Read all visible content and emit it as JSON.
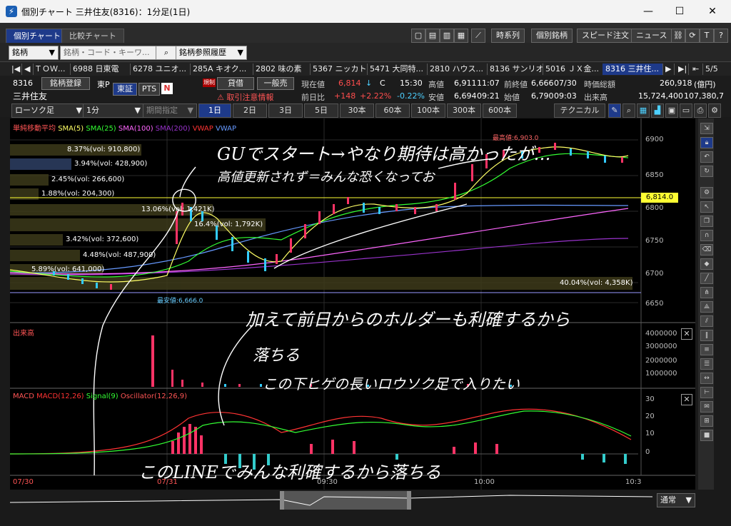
{
  "window": {
    "title": "個別チャート 三井住友(8316)：1分足(1日)",
    "icon_glyph": "⚡"
  },
  "tabs": [
    "個別チャート",
    "比較チャート"
  ],
  "top_buttons": [
    "時系列",
    "個別銘柄",
    "スピード注文",
    "ニュース"
  ],
  "row2": {
    "mode": "銘柄",
    "search_placeholder": "銘柄・コード・キーワ...",
    "history": "銘柄参照履歴"
  },
  "quick_items": [
    "ＴＯＷ...",
    "6988 日東電",
    "6278 ユニオ...",
    "285A キオク...",
    "2802 味の素",
    "5367 ニッカトー",
    "5471 大同特...",
    "2810 ハウス...",
    "8136 サンリオ",
    "5016 ＪＸ金...",
    "8316 三井住..."
  ],
  "quick_page": "5/5",
  "stock": {
    "code": "8316",
    "name": "三井住友",
    "register": "銘柄登録",
    "market": "東P",
    "exchange": "東証",
    "pts": "PTS",
    "lend": "貸借",
    "general": "一般売",
    "warn_badge": "規制",
    "warn": "取引注意情報",
    "current_label": "現在値",
    "current": "6,814",
    "current_arrow": "↓",
    "current_flag": "C",
    "current_time": "15:30",
    "prev_label": "前日比",
    "change": "+148",
    "change_pct": "+2.22%",
    "change2": "-0.22%",
    "high_label": "高値",
    "high": "6,911",
    "high_time": "11:07",
    "low_label": "安値",
    "low": "6,694",
    "low_time": "09:21",
    "prevclose_label": "前終値",
    "prevclose": "6,666",
    "prevclose_date": "07/30",
    "open_label": "始値",
    "open": "6,790",
    "open_time": "09:03",
    "mcap_label": "時価総額",
    "mcap": "260,918",
    "mcap_unit": "(億円)",
    "volume_label": "出来高",
    "volume": "15,724,400",
    "volume2": "107,380,7"
  },
  "toolrow": {
    "chart_type": "ローソク足",
    "interval": "1分",
    "period": "期間指定",
    "periods": [
      "1日",
      "2日",
      "3日",
      "5日",
      "30本",
      "60本",
      "100本",
      "300本",
      "600本"
    ],
    "technical": "テクニカル"
  },
  "legend": {
    "label": "単純移動平均",
    "items": [
      {
        "t": "SMA(5)",
        "c": "#ffff66"
      },
      {
        "t": "SMA(25)",
        "c": "#33ff33"
      },
      {
        "t": "SMA(100)",
        "c": "#ff66ff"
      },
      {
        "t": "SMA(200)",
        "c": "#9933cc"
      },
      {
        "t": "VWAP",
        "c": "#ff3333"
      },
      {
        "t": "VWAP",
        "c": "#6699ff"
      }
    ]
  },
  "volume_profile": [
    "8.37%(vol: 910,800)",
    "3.94%(vol: 428,900)",
    "2.45%(vol: 266,600)",
    "1.88%(vol: 204,300)",
    "13.06%(vol: 1,421K)",
    "16.4%(vol: 1,792K)",
    "3.42%(vol: 372,600)",
    "4.48%(vol: 487,900)",
    "5.89%(vol: 641,000)",
    "40.04%(vol: 4,358K)"
  ],
  "price_axis": [
    "6900",
    "6850",
    "6800",
    "6750",
    "6700",
    "6650"
  ],
  "current_price_tag": "6,814.0",
  "high_label": "最高値:6,903.0",
  "low_label": "最安値:6,666.0",
  "vol_title": "出来高",
  "vol_axis": [
    "4000000",
    "3000000",
    "2000000",
    "1000000"
  ],
  "macd": {
    "label": "MACD",
    "macd": "MACD(12,26)",
    "signal": "Signal(9)",
    "osc": "Oscillator(12,26,9)",
    "axis": [
      "30",
      "20",
      "10",
      "0"
    ]
  },
  "time_axis": [
    "07/30",
    "07/31",
    "09:30",
    "10:00",
    "10:3"
  ],
  "bottom_mode": "通常",
  "notes": [
    "GUでスタート→やなり期待は高かったが…",
    "高値更新されず＝みんな恐くなってお",
    "加えて前日からのホルダーも利確するから",
    "落ちる",
    "この下ヒゲの長いロウソク足で入りたい",
    "このLINEでみんな利確するから落ちる"
  ]
}
